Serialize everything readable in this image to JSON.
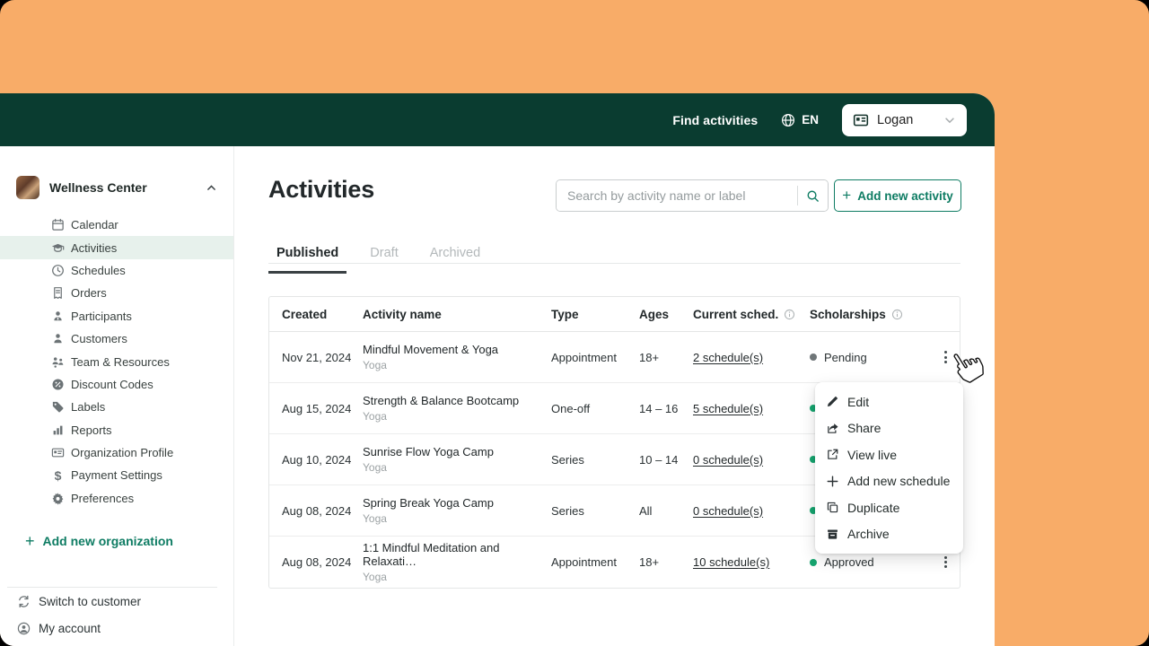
{
  "theme": {
    "orange": "#F8AC68",
    "header_green": "#0A3C30",
    "accent_green": "#0E7C63",
    "active_item_bg": "#E7F1EC",
    "approved_dot": "#16A56F",
    "pending_dot": "#6F7678"
  },
  "header": {
    "find_activities": "Find activities",
    "language": "EN",
    "user_name": "Logan"
  },
  "sidebar": {
    "org_name": "Wellness Center",
    "items": [
      {
        "icon": "calendar",
        "label": "Calendar"
      },
      {
        "icon": "graduation-cap",
        "label": "Activities",
        "active": true
      },
      {
        "icon": "clock",
        "label": "Schedules"
      },
      {
        "icon": "receipt",
        "label": "Orders"
      },
      {
        "icon": "participants",
        "label": "Participants"
      },
      {
        "icon": "person",
        "label": "Customers"
      },
      {
        "icon": "team",
        "label": "Team & Resources"
      },
      {
        "icon": "discount",
        "label": "Discount Codes"
      },
      {
        "icon": "tag",
        "label": "Labels"
      },
      {
        "icon": "bar-chart",
        "label": "Reports"
      },
      {
        "icon": "id-card",
        "label": "Organization Profile"
      },
      {
        "icon": "dollar",
        "label": "Payment Settings"
      },
      {
        "icon": "gear",
        "label": "Preferences"
      }
    ],
    "add_new_org": "Add new organization",
    "switch_to_customer": "Switch to customer",
    "my_account": "My account"
  },
  "main": {
    "title": "Activities",
    "search_placeholder": "Search by activity name or label",
    "add_button": "Add new activity",
    "tabs": [
      {
        "label": "Published",
        "active": true
      },
      {
        "label": "Draft",
        "active": false
      },
      {
        "label": "Archived",
        "active": false
      }
    ],
    "table": {
      "columns": [
        {
          "label": "Created"
        },
        {
          "label": "Activity name"
        },
        {
          "label": "Type"
        },
        {
          "label": "Ages"
        },
        {
          "label": "Current sched.",
          "info": true
        },
        {
          "label": "Scholarships",
          "info": true
        }
      ],
      "rows": [
        {
          "created": "Nov 21, 2024",
          "name": "Mindful Movement & Yoga",
          "label": "Yoga",
          "type": "Appointment",
          "ages": "18+",
          "schedules": "2 schedule(s)",
          "status": {
            "dot": "pending",
            "label": "Pending"
          }
        },
        {
          "created": "Aug 15, 2024",
          "name": "Strength & Balance Bootcamp",
          "label": "Yoga",
          "type": "One-off",
          "ages": "14 – 16",
          "schedules": "5 schedule(s)",
          "status": {
            "dot": "approved",
            "label": ""
          }
        },
        {
          "created": "Aug 10, 2024",
          "name": "Sunrise Flow Yoga Camp",
          "label": "Yoga",
          "type": "Series",
          "ages": "10 – 14",
          "schedules": "0 schedule(s)",
          "status": {
            "dot": "approved",
            "label": ""
          }
        },
        {
          "created": "Aug 08, 2024",
          "name": "Spring Break Yoga Camp",
          "label": "Yoga",
          "type": "Series",
          "ages": "All",
          "schedules": "0 schedule(s)",
          "status": {
            "dot": "approved",
            "label": ""
          }
        },
        {
          "created": "Aug 08, 2024",
          "name": "1:1 Mindful Meditation and Relaxati…",
          "label": "Yoga",
          "type": "Appointment",
          "ages": "18+",
          "schedules": "10 schedule(s)",
          "status": {
            "dot": "approved",
            "label": "Approved"
          }
        }
      ]
    },
    "row_menu": [
      {
        "icon": "edit",
        "label": "Edit"
      },
      {
        "icon": "share",
        "label": "Share"
      },
      {
        "icon": "external-link",
        "label": "View live"
      },
      {
        "icon": "plus",
        "label": "Add new schedule"
      },
      {
        "icon": "duplicate",
        "label": "Duplicate"
      },
      {
        "icon": "archive",
        "label": "Archive"
      }
    ]
  }
}
